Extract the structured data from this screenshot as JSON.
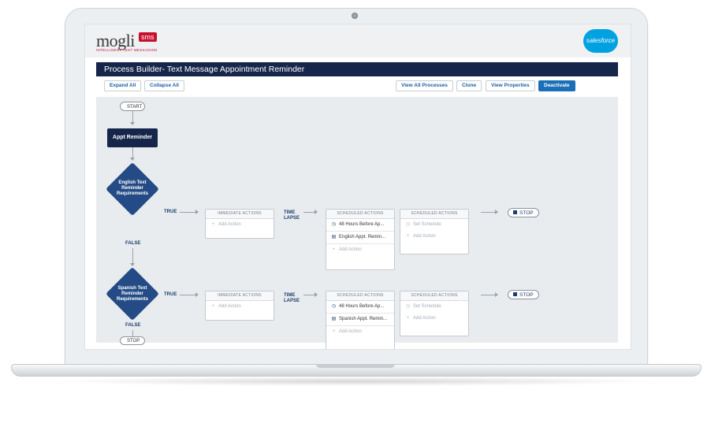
{
  "brand": {
    "logo": "mogli",
    "logo_badge": "sms",
    "tagline": "INTELLIGENT TEXT MESSAGING",
    "partner": "salesforce"
  },
  "header": {
    "title": "Process Builder- Text Message Appointment Reminder"
  },
  "toolbar": {
    "expand_all": "Expand All",
    "collapse_all": "Collapse All",
    "view_all_processes": "View All Processes",
    "clone": "Clone",
    "view_properties": "View Properties",
    "deactivate": "Deactivate"
  },
  "flow": {
    "start": "START",
    "object_node": "Appt Reminder",
    "criteria": [
      {
        "label": "English Text Reminder Requirements",
        "true_label": "TRUE",
        "false_label": "FALSE",
        "immediate_header": "IMMEDIATE ACTIONS",
        "immediate_add": "Add Action",
        "time_lapse": "TIME LAPSE",
        "scheduled_header": "SCHEDULED ACTIONS",
        "schedule_time": "48 Hours Before Ap...",
        "schedule_action": "English Appt. Remin...",
        "schedule_add": "Add Action",
        "scheduled2_header": "SCHEDULED ACTIONS",
        "set_schedule": "Set Schedule",
        "scheduled2_add": "Add Action",
        "stop": "STOP"
      },
      {
        "label": "Spanish Text Reminder Requirements",
        "true_label": "TRUE",
        "false_label": "FALSE",
        "immediate_header": "IMMEDIATE ACTIONS",
        "immediate_add": "Add Action",
        "time_lapse": "TIME LAPSE",
        "scheduled_header": "SCHEDULED ACTIONS",
        "schedule_time": "48 Hours Before Ap...",
        "schedule_action": "Spanish Appt. Remin...",
        "schedule_add": "Add Action",
        "scheduled2_header": "SCHEDULED ACTIONS",
        "set_schedule": "Set Schedule",
        "scheduled2_add": "Add Action",
        "stop": "STOP"
      }
    ],
    "end_stop": "STOP"
  },
  "colors": {
    "navy": "#15264a",
    "diamond": "#244b86",
    "accent": "#1a6fb8",
    "brand_red": "#c8102e",
    "salesforce": "#00a1e0"
  },
  "icons": {
    "clock": "clock-icon",
    "action": "message-icon",
    "add": "plus-icon",
    "stop": "stop-icon"
  }
}
